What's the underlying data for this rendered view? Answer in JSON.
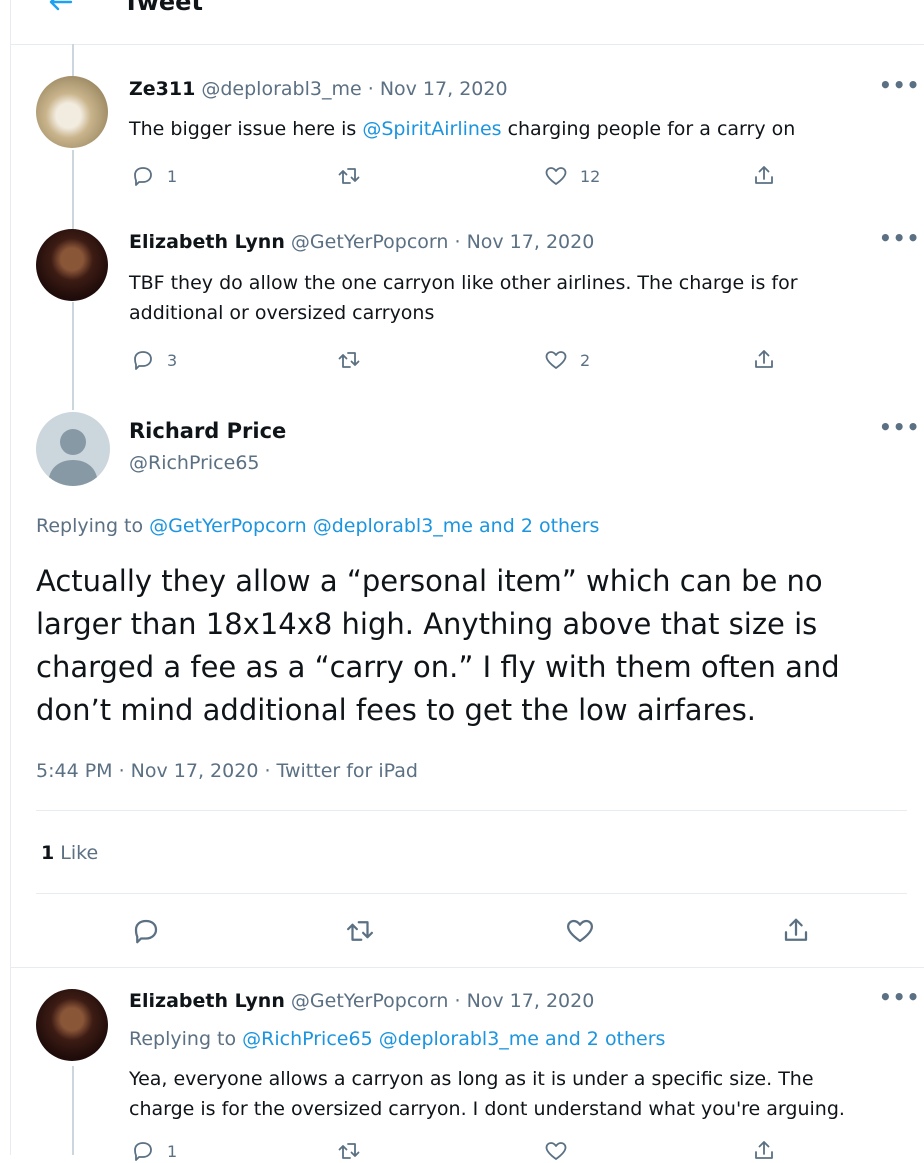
{
  "header": {
    "title": "Tweet"
  },
  "replies_above": [
    {
      "name": "Ze311",
      "handle": "@deplorabl3_me",
      "sep": "·",
      "date": "Nov 17, 2020",
      "text_before": "The bigger issue here is ",
      "mention": "@SpiritAirlines",
      "text_after": " charging people for a carry on",
      "reply_count": "1",
      "retweet_count": "",
      "like_count": "12"
    },
    {
      "name": "Elizabeth Lynn",
      "handle": "@GetYerPopcorn",
      "sep": "·",
      "date": "Nov 17, 2020",
      "text_line1": "TBF they do allow the one carryon like other airlines. The charge is for",
      "text_line2": "additional or oversized carryons",
      "reply_count": "3",
      "retweet_count": "",
      "like_count": "2"
    }
  ],
  "main_tweet": {
    "name": "Richard Price",
    "handle": "@RichPrice65",
    "replying_label": "Replying to ",
    "replying_to": "@GetYerPopcorn @deplorabl3_me and 2 others",
    "text_lines": [
      "Actually they allow a “personal item” which can be no",
      "larger than 18x14x8 high. Anything above that size is",
      "charged a fee as a “carry on.” I fly with them often and",
      "don’t mind additional fees to get the low airfares."
    ],
    "timestamp": "5:44 PM · Nov 17, 2020 · Twitter for iPad",
    "like_count": "1",
    "like_label": "Like"
  },
  "replies_below": [
    {
      "name": "Elizabeth Lynn",
      "handle": "@GetYerPopcorn",
      "sep": "·",
      "date": "Nov 17, 2020",
      "replying_label": "Replying to ",
      "replying_to": "@RichPrice65 @deplorabl3_me and 2 others",
      "text_line1": "Yea, everyone allows a carryon as long as it is under a specific size. The",
      "text_line2": "charge is for the oversized carryon. I dont understand what you're arguing.",
      "reply_count": "1"
    }
  ],
  "icons": {
    "back": "arrow-left-icon",
    "more": "more-icon",
    "reply": "reply-icon",
    "retweet": "retweet-icon",
    "like": "heart-icon",
    "share": "share-icon"
  },
  "colors": {
    "accent": "#1b95e0",
    "text": "#0f1419",
    "muted": "#5b7083",
    "divider": "#e6ecf0"
  }
}
